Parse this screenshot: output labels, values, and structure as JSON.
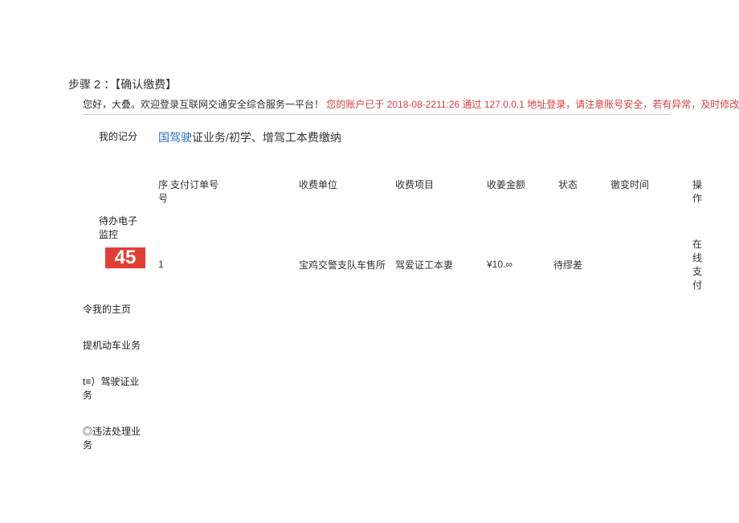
{
  "step": {
    "prefix": "步骤",
    "number": "2",
    "label": "：【确认缴费】"
  },
  "welcome": {
    "greeting": "您好，大叠。欢迎登录互联网交通安全综合服务一平台！",
    "alert": "您的账户已于 2018-08-2211:26 通过 127.0.0.1 地址登录，请注意账号安全，若有异常，及时修改军码."
  },
  "sidebar": {
    "myPoints": "我的记分",
    "pendingLabel": "待办电子监控",
    "pendingCount": "45",
    "items": [
      "令我的主页",
      "提机动车业务",
      "t≡）驾驶证业务",
      "◎违法处理业务"
    ]
  },
  "breadcrumb": {
    "blue": "国驾驶",
    "rest": "证业务/初学、增驾工本费缴纳"
  },
  "table": {
    "headers": {
      "idx": "序号",
      "orderno": "支付订单号",
      "unit": "收费单位",
      "item": "收费项目",
      "amount": "收姜金额",
      "status": "状态",
      "time": "徼变时间",
      "action": "操作"
    },
    "rows": [
      {
        "idx": "1",
        "orderno": "",
        "unit": "宝鸡交警支队车售所",
        "item": "驾爱证工本妻",
        "amount": "¥10.∞",
        "status": "待缪差",
        "time": "",
        "action": "在线支付"
      }
    ]
  }
}
